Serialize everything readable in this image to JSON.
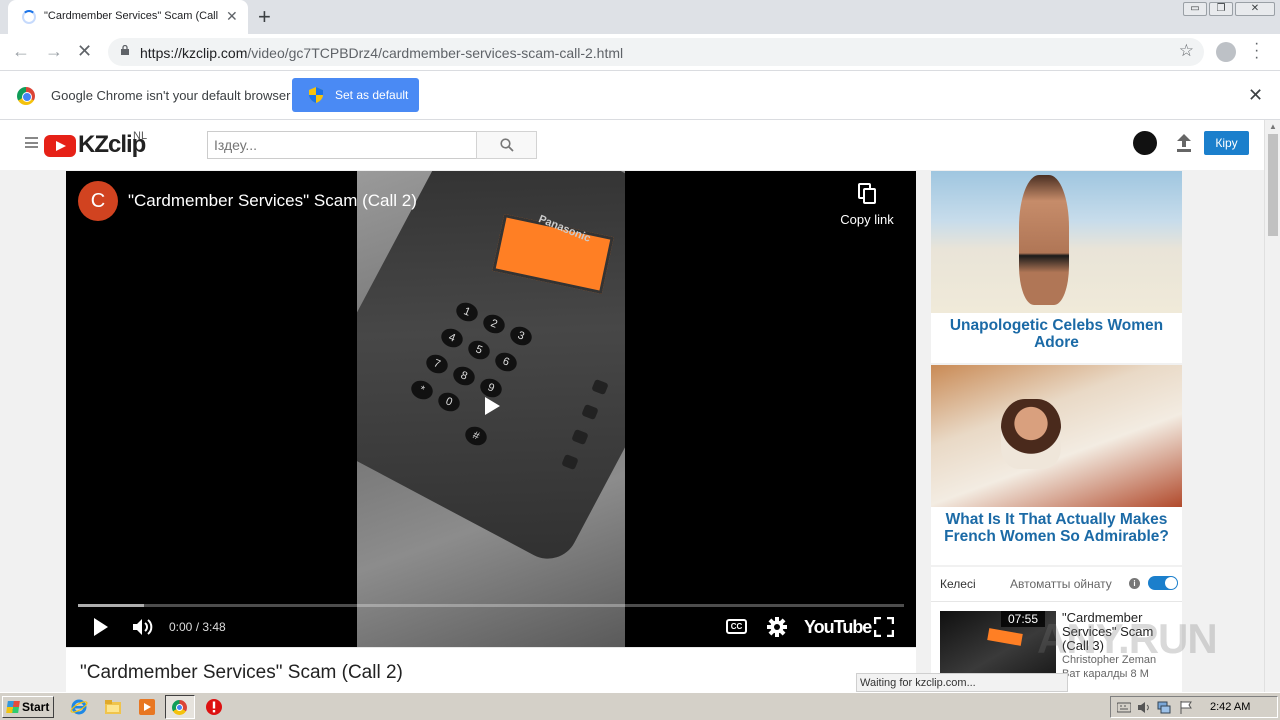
{
  "browser": {
    "tab_title": "\"Cardmember Services\" Scam (Call 2",
    "tab_close": "✕",
    "new_tab": "+",
    "url_host": "https://kzclip.com",
    "url_path": "/video/gc7TCPBDrz4/cardmember-services-scam-call-2.html",
    "window_controls": [
      "▭",
      "❐",
      "✕"
    ]
  },
  "infobar": {
    "message": "Google Chrome isn't your default browser",
    "button": "Set as default",
    "close": "✕"
  },
  "site": {
    "logo": "KZclip",
    "region": "NL",
    "search_placeholder": "Іздеу...",
    "login": "Кіру"
  },
  "player": {
    "channel_initial": "C",
    "title": "\"Cardmember Services\" Scam (Call 2)",
    "copy_link": "Copy link",
    "time": "0:00 / 3:48",
    "loaded_fraction": 0.08,
    "cc": "CC",
    "youtube_logo": "YouTube"
  },
  "phone": {
    "brand": "Panasonic",
    "keys": [
      "1",
      "2",
      "3",
      "4",
      "5",
      "6",
      "7",
      "8",
      "9",
      "*",
      "0",
      "#"
    ]
  },
  "video_heading": "\"Cardmember Services\" Scam (Call 2)",
  "ads": [
    {
      "caption": "Unapologetic Celebs Women Adore"
    },
    {
      "caption": "What Is It That Actually Makes French Women So Admirable?"
    }
  ],
  "up_next": {
    "label": "Келесі",
    "autoplay_label": "Автоматты ойнату",
    "autoplay_on": true,
    "video": {
      "title": "\"Cardmember Services\" Scam (Call 3)",
      "duration": "07:55",
      "channel": "Christopher Zeman",
      "views": "Ват каралды 8 М"
    }
  },
  "watermark": "ANY.RUN",
  "status_text": "Waiting for kzclip.com...",
  "taskbar": {
    "start": "Start",
    "clock": "2:42 AM"
  },
  "colors": {
    "chrome_blue": "#4a8af4",
    "kzclip_red": "#e62117",
    "link_blue": "#1b6aa6",
    "login_blue": "#1b7fcc",
    "phone_display": "#ff7f24"
  }
}
